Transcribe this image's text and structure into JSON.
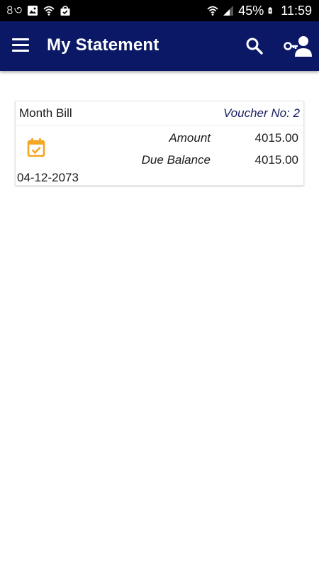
{
  "status_bar": {
    "left_text": "৪৩",
    "battery": "45%",
    "time": "11:59"
  },
  "app_bar": {
    "title": "My Statement",
    "color": "#0a1866"
  },
  "statement": {
    "items": [
      {
        "bill_type": "Month Bill",
        "voucher": "Voucher No: 2",
        "amount_label": "Amount",
        "amount": "4015.00",
        "due_label": "Due Balance",
        "due_balance": "4015.00",
        "date": "04-12-2073",
        "icon": "calendar-check-icon",
        "icon_color": "#f5a623"
      }
    ]
  }
}
